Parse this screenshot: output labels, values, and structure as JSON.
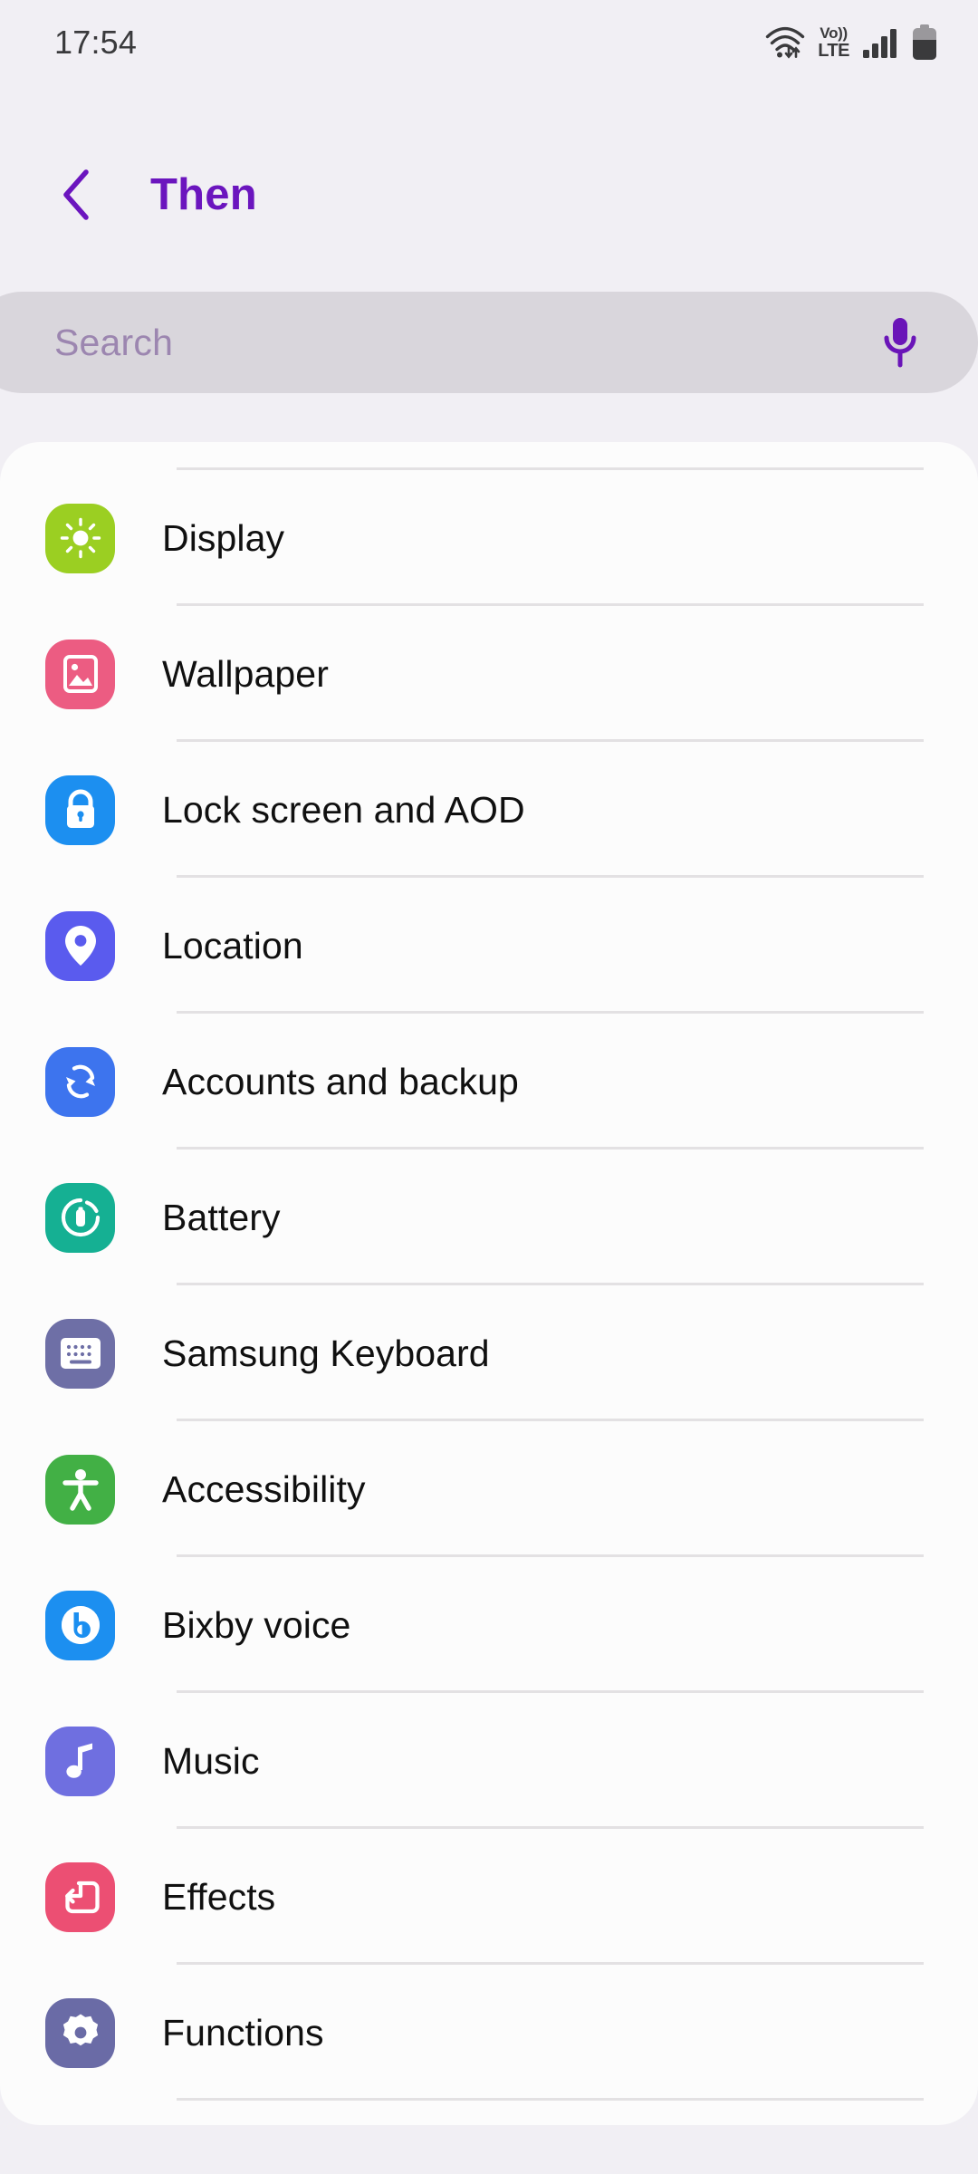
{
  "status_bar": {
    "time": "17:54",
    "icons": [
      {
        "name": "wifi-icon",
        "label": "Wi-Fi with data transfer"
      },
      {
        "name": "volte-icon",
        "top": "Vo))",
        "bottom": "LTE"
      },
      {
        "name": "cellular-signal-icon",
        "label": "Mobile signal"
      },
      {
        "name": "battery-icon",
        "label": "Battery"
      }
    ]
  },
  "header": {
    "back_label": "Back",
    "title": "Then"
  },
  "search": {
    "placeholder": "Search",
    "mic_label": "Voice search"
  },
  "colors": {
    "background": "#F1EFF4",
    "card": "#FCFCFC",
    "accent_purple": "#6B15BE",
    "search_field": "#D9D6DC",
    "search_placeholder": "#9C86B0",
    "divider": "#E3E1E3",
    "label_text": "#101010"
  },
  "list": {
    "items": [
      {
        "label": "Display",
        "icon": "brightness-sun-icon",
        "icon_bg": "#9BCF22"
      },
      {
        "label": "Wallpaper",
        "icon": "image-picture-icon",
        "icon_bg": "#EC5C82"
      },
      {
        "label": "Lock screen and AOD",
        "icon": "padlock-icon",
        "icon_bg": "#1C8FF0"
      },
      {
        "label": "Location",
        "icon": "map-pin-icon",
        "icon_bg": "#5A5BEE"
      },
      {
        "label": "Accounts and backup",
        "icon": "sync-arrows-icon",
        "icon_bg": "#3D74EE"
      },
      {
        "label": "Battery",
        "icon": "battery-circle-icon",
        "icon_bg": "#15B093"
      },
      {
        "label": "Samsung Keyboard",
        "icon": "keyboard-icon",
        "icon_bg": "#6E6FA6"
      },
      {
        "label": "Accessibility",
        "icon": "accessibility-person-icon",
        "icon_bg": "#42B045"
      },
      {
        "label": "Bixby voice",
        "icon": "bixby-logo-icon",
        "icon_bg": "#1C8FF0"
      },
      {
        "label": "Music",
        "icon": "music-note-icon",
        "icon_bg": "#6F6FE0"
      },
      {
        "label": "Effects",
        "icon": "effects-frame-icon",
        "icon_bg": "#EC4F73"
      },
      {
        "label": "Functions",
        "icon": "gear-settings-icon",
        "icon_bg": "#6A6BA6"
      }
    ]
  }
}
